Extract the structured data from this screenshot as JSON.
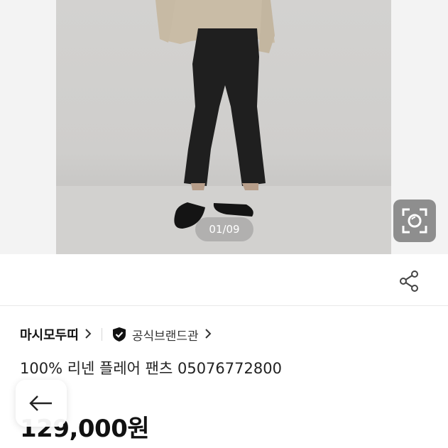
{
  "gallery": {
    "counter": "01/09",
    "camera_icon": "camera-scan-icon"
  },
  "actions": {
    "share_icon": "share-icon",
    "back_icon": "back-arrow-icon"
  },
  "brand": {
    "name": "마시모두띠",
    "official_label": "공식브랜드관",
    "official_icon": "verified-shield-icon"
  },
  "product": {
    "title": "100% 리넨 플레어 팬츠 05076772800",
    "price": "129,000원"
  },
  "colors": {
    "accent_gray": "#8e8e8e",
    "text": "#1a1a1a"
  }
}
